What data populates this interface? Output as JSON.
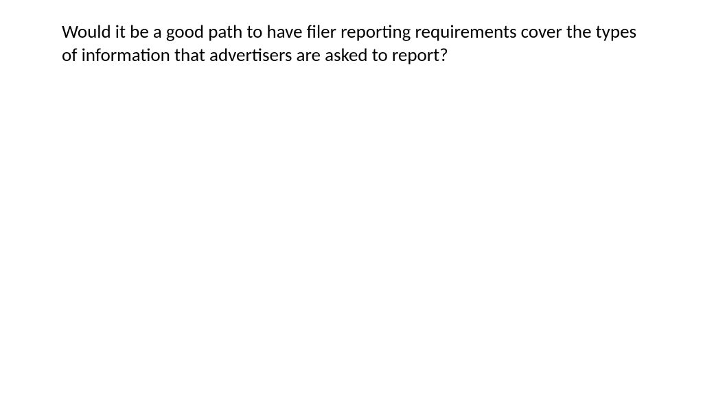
{
  "slide": {
    "heading": "Would it be a good path to have filer reporting requirements cover the types of information that advertisers are asked to report?"
  }
}
